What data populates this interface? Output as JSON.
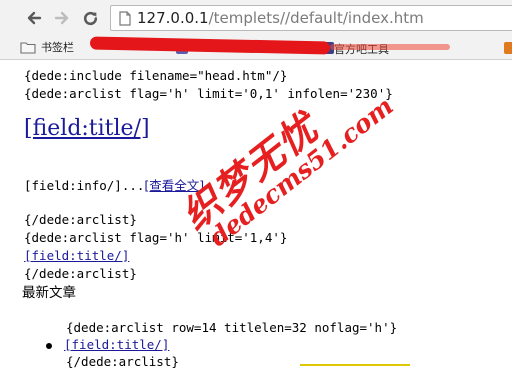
{
  "browser": {
    "url_host": "127.0.0.1",
    "url_path": "/templets//default/index.htm",
    "bookmarks_label": "书签栏",
    "bookmarks_ext_label": "官方吧工具",
    "colors": {
      "toolbar": "#f2f2f2",
      "redaction": "#e4161a",
      "link": "#1a1a9b"
    }
  },
  "page": {
    "line1": "{dede:include filename=\"head.htm\"/}",
    "line2": "{dede:arclist flag='h' limit='0,1' infolen='230'}",
    "big_title": "[field:title/]",
    "info_prefix": "[field:info/]...",
    "read_more": "[查看全文]",
    "close_arclist_1": "{/dede:arclist}",
    "line_arclist2": "{dede:arclist flag='h' limit='1,4'}",
    "field_title_link": "[field:title/]",
    "close_arclist_2": "{/dede:arclist}",
    "latest_heading": "最新文章",
    "line_arclist3": "{dede:arclist row=14 titlelen=32 noflag='h'}",
    "list_item_link": "[field:title/]",
    "close_arclist_3": "{/dede:arclist}"
  },
  "watermark": {
    "cjk": "织梦无忧",
    "url": "dedecms51.com"
  }
}
